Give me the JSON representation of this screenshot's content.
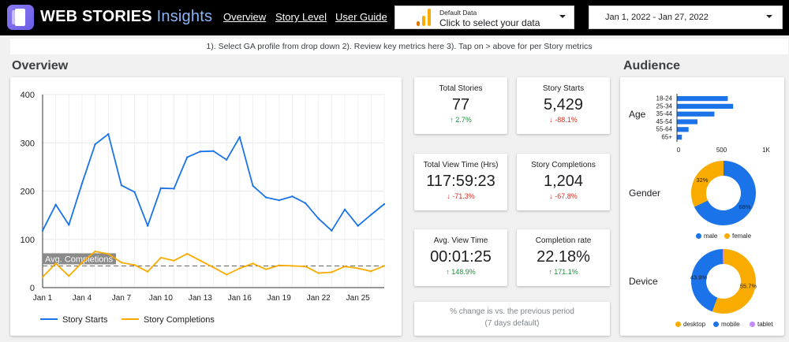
{
  "header": {
    "brand_bold": "WEB STORIES",
    "brand_light": "Insights",
    "nav": [
      "Overview",
      "Story Level",
      "User Guide"
    ],
    "data_source": {
      "label": "Default Data",
      "value": "Click to select your data"
    },
    "date_range": "Jan 1, 2022 - Jan 27, 2022"
  },
  "instructions": "1). Select GA profile from drop down 2). Review key metrics here 3). Tap on > above for per Story metrics",
  "overview": {
    "title": "Overview"
  },
  "audience": {
    "title": "Audience"
  },
  "chart_data": [
    {
      "type": "line",
      "x": [
        "Jan 1",
        "Jan 2",
        "Jan 3",
        "Jan 4",
        "Jan 5",
        "Jan 6",
        "Jan 7",
        "Jan 8",
        "Jan 9",
        "Jan 10",
        "Jan 11",
        "Jan 12",
        "Jan 13",
        "Jan 14",
        "Jan 15",
        "Jan 16",
        "Jan 17",
        "Jan 18",
        "Jan 19",
        "Jan 20",
        "Jan 21",
        "Jan 22",
        "Jan 23",
        "Jan 24",
        "Jan 25",
        "Jan 26",
        "Jan 27"
      ],
      "xticks": [
        "Jan 1",
        "Jan 4",
        "Jan 7",
        "Jan 10",
        "Jan 13",
        "Jan 16",
        "Jan 19",
        "Jan 22",
        "Jan 25"
      ],
      "yticks": [
        0,
        100,
        200,
        300,
        400
      ],
      "ylim": [
        0,
        400
      ],
      "series": [
        {
          "name": "Story Starts",
          "color": "#1a73e8",
          "values": [
            118,
            172,
            130,
            216,
            297,
            318,
            212,
            198,
            128,
            206,
            205,
            270,
            282,
            283,
            265,
            312,
            211,
            187,
            181,
            189,
            175,
            143,
            118,
            162,
            128,
            151,
            173
          ]
        },
        {
          "name": "Story Completions",
          "color": "#f9ab00",
          "values": [
            22,
            50,
            24,
            52,
            75,
            70,
            52,
            47,
            33,
            62,
            56,
            70,
            56,
            42,
            27,
            40,
            50,
            38,
            46,
            45,
            44,
            30,
            32,
            44,
            40,
            34,
            45
          ]
        }
      ],
      "reference": {
        "label": "Avg. Completions",
        "value": 45
      },
      "legend": "bottom-left",
      "grid": true
    },
    {
      "type": "bar",
      "orientation": "horizontal",
      "ylabel": "Age",
      "categories": [
        "18-24",
        "25-34",
        "35-44",
        "45-54",
        "55-64",
        "65+"
      ],
      "values": [
        570,
        630,
        420,
        230,
        130,
        55
      ],
      "xticks": [
        "0",
        "500",
        "1K"
      ],
      "xlim": [
        0,
        1000
      ],
      "color": "#1a73e8"
    },
    {
      "type": "pie",
      "title": "Gender",
      "donut": true,
      "labels": [
        "male",
        "female"
      ],
      "values": [
        68,
        32
      ],
      "slice_labels": [
        "68%",
        "32%"
      ],
      "colors": [
        "#1a73e8",
        "#f9ab00"
      ]
    },
    {
      "type": "pie",
      "title": "Device",
      "donut": true,
      "labels": [
        "desktop",
        "mobile",
        "tablet"
      ],
      "values": [
        55.7,
        43.9,
        0.4
      ],
      "slice_labels": [
        "55.7%",
        "43.9%",
        ""
      ],
      "colors": [
        "#f9ab00",
        "#1a73e8",
        "#c58af9"
      ]
    }
  ],
  "kpis": [
    {
      "label": "Total Stories",
      "value": "77",
      "change": "2.7%",
      "direction": "up"
    },
    {
      "label": "Story Starts",
      "value": "5,429",
      "change": "-88.1%",
      "direction": "down"
    },
    {
      "label": "Total View Time (Hrs)",
      "value": "117:59:23",
      "change": "-71.3%",
      "direction": "down"
    },
    {
      "label": "Story Completions",
      "value": "1,204",
      "change": "-67.8%",
      "direction": "down"
    },
    {
      "label": "Avg. View Time",
      "value": "00:01:25",
      "change": "148.9%",
      "direction": "up"
    },
    {
      "label": "Completion rate",
      "value": "22.18%",
      "change": "171.1%",
      "direction": "up"
    }
  ],
  "note": {
    "line1": "% change is vs. the previous period",
    "line2": "(7 days default)"
  },
  "icons": {
    "logo": "story-book-icon",
    "data_source": "analytics-icon",
    "dropdown": "caret-down-icon",
    "up": "arrow-up-icon",
    "down": "arrow-down-icon"
  }
}
